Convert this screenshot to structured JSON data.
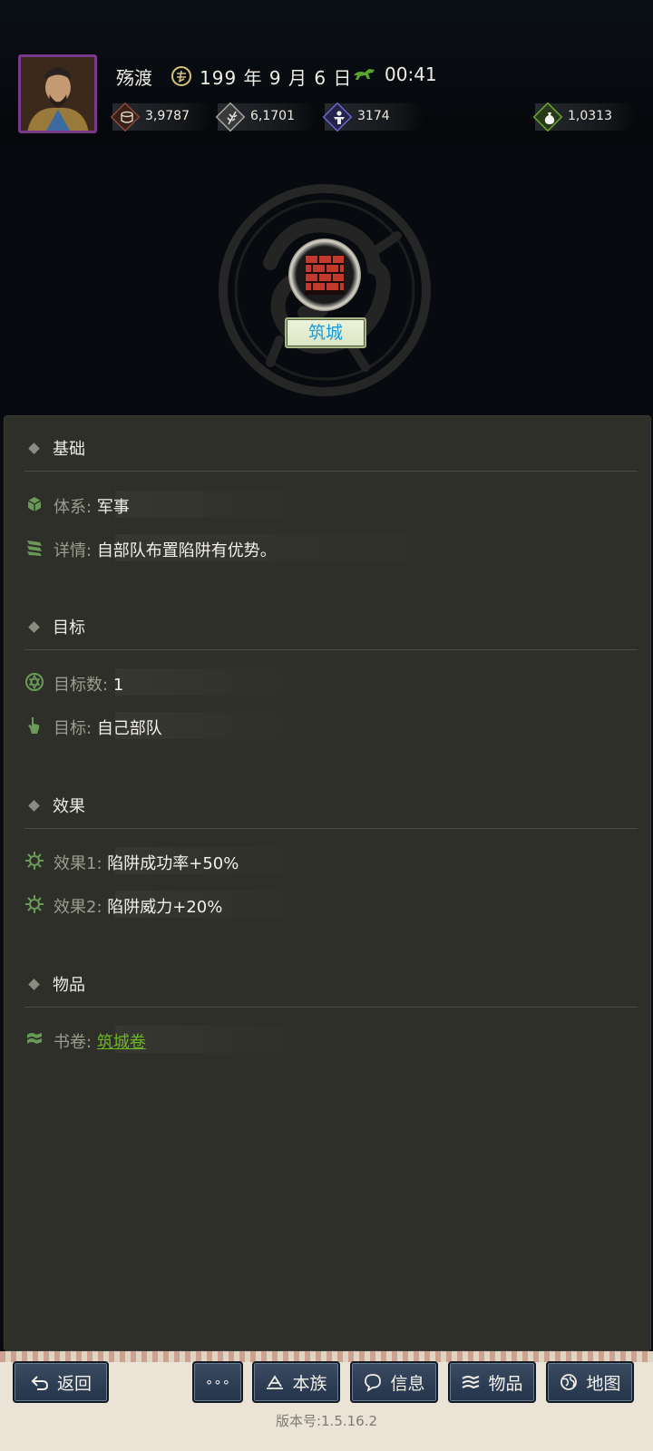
{
  "header": {
    "player_name": "殇渡",
    "date": "199 年 9 月 6 日",
    "time": "00:41",
    "resources": [
      {
        "name": "gold",
        "value": "3,9787",
        "color": "#8a4a3a"
      },
      {
        "name": "food",
        "value": "6,1701",
        "color": "#9a9a9a"
      },
      {
        "name": "troops",
        "value": "3174",
        "color": "#5a5ab0"
      },
      {
        "name": "jade",
        "value": "1,0313",
        "color": "#5c8a28"
      }
    ]
  },
  "skill": {
    "name": "筑城",
    "icon": "brick-wall-icon"
  },
  "sections": {
    "basic": {
      "title": "基础",
      "system_label": "体系:",
      "system_value": "军事",
      "detail_label": "详情:",
      "detail_value": "自部队布置陷阱有优势。"
    },
    "target": {
      "title": "目标",
      "count_label": "目标数:",
      "count_value": "1",
      "target_label": "目标:",
      "target_value": "自己部队"
    },
    "effect": {
      "title": "效果",
      "effect1_label": "效果1:",
      "effect1_value": "陷阱成功率+50%",
      "effect2_label": "效果2:",
      "effect2_value": "陷阱威力+20%"
    },
    "items": {
      "title": "物品",
      "book_label": "书卷:",
      "book_value": "筑城卷"
    }
  },
  "bottom": {
    "back": "返回",
    "more": "∘∘∘",
    "clan": "本族",
    "info": "信息",
    "items": "物品",
    "map": "地图",
    "version": "版本号:1.5.16.2"
  }
}
